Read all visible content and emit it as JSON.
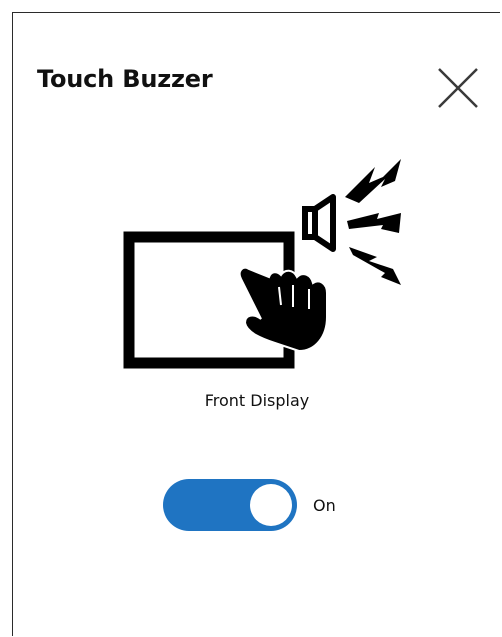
{
  "dialog": {
    "title": "Touch Buzzer",
    "close_icon": "close-icon"
  },
  "illustration": {
    "icon": "touch-buzzer-icon",
    "caption": "Front Display"
  },
  "toggle": {
    "state": true,
    "state_label": "On",
    "accent_color": "#1f74c2"
  }
}
